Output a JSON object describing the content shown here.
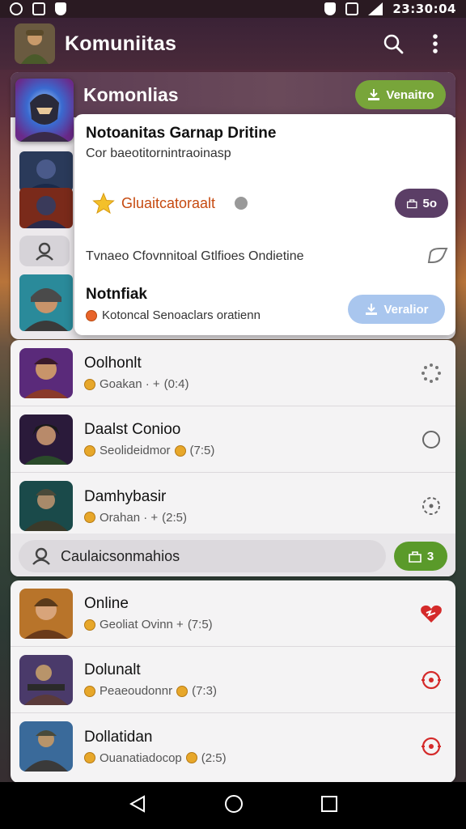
{
  "status": {
    "time": "23:30:04"
  },
  "appbar": {
    "title": "Komuniitas",
    "search_icon": "search-icon",
    "more_icon": "more-vert-icon"
  },
  "featured": {
    "title": "Komonlias",
    "action_label": "Venaitro",
    "popup": {
      "title": "Notoanitas Garnap Dritine",
      "subtitle": "Cor baeotitornintraoinasp",
      "rating_label": "Gluaitcatoraalt",
      "rating_badge": "5o",
      "description": "Tvnaeo Cfovnnitoal Gtlfioes Ondietine",
      "item_title": "Notnfiak",
      "item_meta": "Kotoncal Senoaclars oratienn",
      "item_action": "Veralior"
    }
  },
  "list_group1": [
    {
      "name": "Oolhonlt",
      "meta": "Goakan · +",
      "count": "(0:4)",
      "action_icon": "loading-dots-icon"
    },
    {
      "name": "Daalst Conioo",
      "meta": "Seolideidmor",
      "count": "(7:5)",
      "action_icon": "circle-outline-icon"
    },
    {
      "name": "Damhybasir",
      "meta": "Orahan · +",
      "count": "(2:5)",
      "action_icon": "target-dots-icon"
    }
  ],
  "search": {
    "value": "Caulaicsonmahios",
    "badge": "3"
  },
  "list_group2": [
    {
      "name": "Online",
      "meta": "Geoliat Ovinn  +",
      "count": "(7:5)",
      "action_icon": "broken-heart-icon"
    },
    {
      "name": "Dolunalt",
      "meta": "Peaeoudonnr",
      "count": "(7:3)",
      "action_icon": "target-icon"
    },
    {
      "name": "Dollatidan",
      "meta": "Ouanatiadocop",
      "count": "(2:5)",
      "action_icon": "target-icon"
    }
  ],
  "nav": {
    "back_icon": "back-icon",
    "home_icon": "home-icon",
    "recents_icon": "recents-icon"
  },
  "colors": {
    "green": "#78a53a",
    "purple": "#5b3e66",
    "light_blue": "#a9c6ee",
    "red_action": "#d42a2a"
  }
}
